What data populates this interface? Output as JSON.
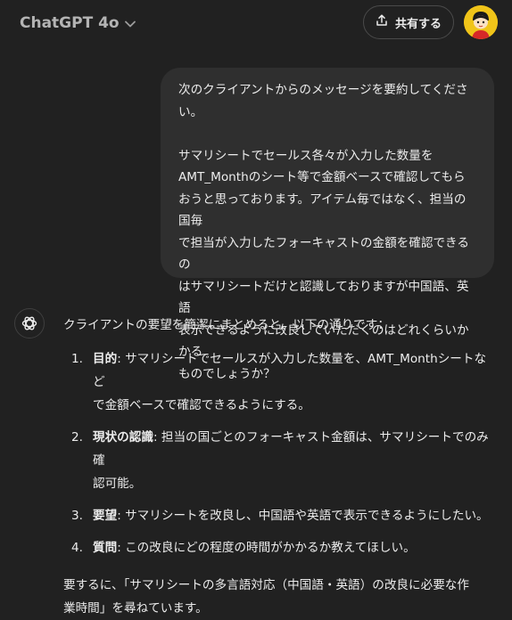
{
  "header": {
    "model_name": "ChatGPT 4o",
    "share_label": "共有する"
  },
  "colors": {
    "background": "#212121",
    "user_bubble": "#2f2f2f",
    "text": "#ececec",
    "avatar_accent": "#f0c419"
  },
  "icons": {
    "model_dropdown": "chevron-down-icon",
    "share": "share-icon",
    "user": "avatar",
    "assistant": "openai-logo-icon"
  },
  "user_message": {
    "line1": "次のクライアントからのメッセージを要約してください。",
    "body_lines": [
      "サマリシートでセールス各々が入力した数量を",
      "AMT_Monthのシート等で金額ベースで確認してもら",
      "おうと思っております。アイテム毎ではなく、担当の国毎",
      "で担当が入力したフォーキャストの金額を確認できるの",
      "はサマリシートだけと認識しておりますが中国語、英語",
      "表示できるように改良していただくのはどれくらいかかる",
      "ものでしょうか？"
    ]
  },
  "assistant_message": {
    "intro": "クライアントの要望を簡潔にまとめると、以下の通りです：",
    "items": [
      {
        "num": "1.",
        "title": "目的",
        "sep": ": ",
        "text_lines": [
          "サマリシートでセールスが入力した数量を、AMT_Monthシートなど",
          "で金額ベースで確認できるようにする。"
        ]
      },
      {
        "num": "2.",
        "title": "現状の認識",
        "sep": ": ",
        "text_lines": [
          "担当の国ごとのフォーキャスト金額は、サマリシートでのみ確",
          "認可能。"
        ]
      },
      {
        "num": "3.",
        "title": "要望",
        "sep": ": ",
        "text_lines": [
          "サマリシートを改良し、中国語や英語で表示できるようにしたい。"
        ]
      },
      {
        "num": "4.",
        "title": "質問",
        "sep": ": ",
        "text_lines": [
          "この改良にどの程度の時間がかかるか教えてほしい。"
        ]
      }
    ],
    "summary_lines": [
      "要するに、「サマリシートの多言語対応（中国語・英語）の改良に必要な作",
      "業時間」を尋ねています。"
    ]
  }
}
